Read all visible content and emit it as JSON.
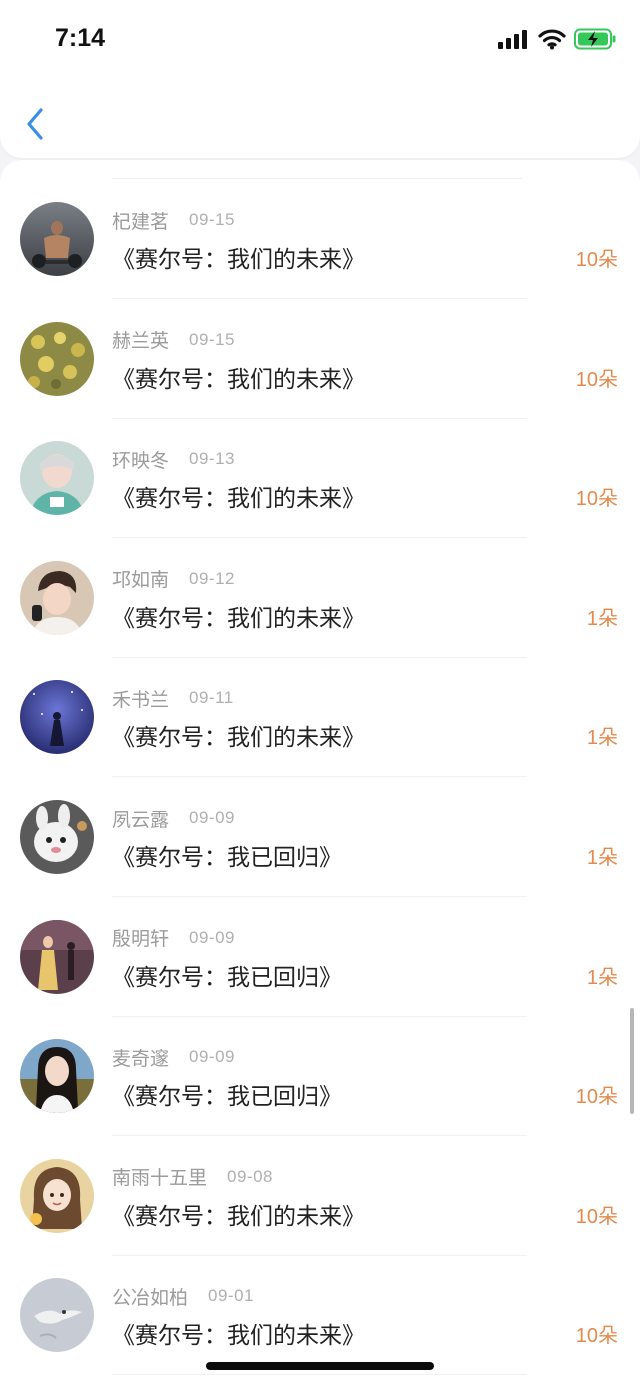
{
  "status_bar": {
    "time": "7:14",
    "icons": [
      "signal-icon",
      "wifi-icon",
      "battery-charging-icon"
    ]
  },
  "nav": {
    "back_icon": "chevron-left-icon"
  },
  "colors": {
    "accent": "#3a8ee6",
    "amount": "#e58a4c",
    "battery": "#35c759"
  },
  "gifts": [
    {
      "name": "杞建茗",
      "date": "09-15",
      "title": "《赛尔号：我们的未来》",
      "amount": "10朵"
    },
    {
      "name": "赫兰英",
      "date": "09-15",
      "title": "《赛尔号：我们的未来》",
      "amount": "10朵"
    },
    {
      "name": "环映冬",
      "date": "09-13",
      "title": "《赛尔号：我们的未来》",
      "amount": "10朵"
    },
    {
      "name": "邛如南",
      "date": "09-12",
      "title": "《赛尔号：我们的未来》",
      "amount": "1朵"
    },
    {
      "name": "禾书兰",
      "date": "09-11",
      "title": "《赛尔号：我们的未来》",
      "amount": "1朵"
    },
    {
      "name": "夙云露",
      "date": "09-09",
      "title": "《赛尔号：我已回归》",
      "amount": "1朵"
    },
    {
      "name": "殷明轩",
      "date": "09-09",
      "title": "《赛尔号：我已回归》",
      "amount": "1朵"
    },
    {
      "name": "麦奇邃",
      "date": "09-09",
      "title": "《赛尔号：我已回归》",
      "amount": "10朵"
    },
    {
      "name": "南雨十五里",
      "date": "09-08",
      "title": "《赛尔号：我们的未来》",
      "amount": "10朵"
    },
    {
      "name": "公冶如柏",
      "date": "09-01",
      "title": "《赛尔号：我们的未来》",
      "amount": "10朵"
    }
  ]
}
